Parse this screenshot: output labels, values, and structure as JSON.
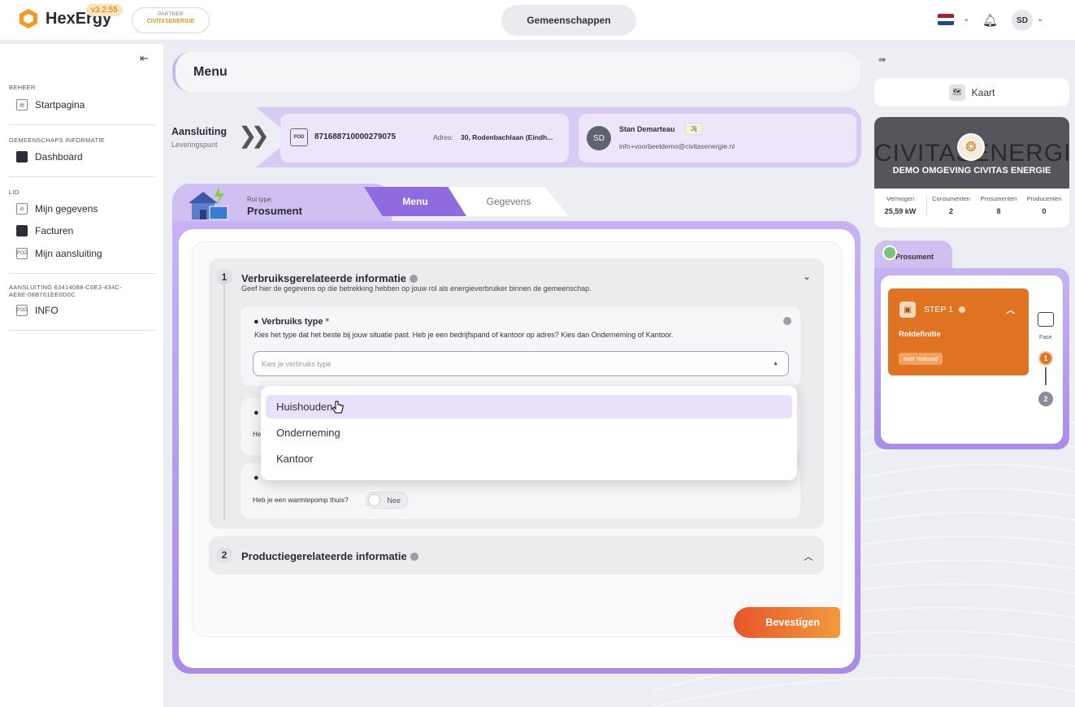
{
  "app": {
    "name": "HexErgy",
    "version": "v3.2.55",
    "partner_label": "PARTNER",
    "partner_name": "CIVITASENERGIE"
  },
  "header": {
    "center_button": "Gemeenschappen",
    "user_initials": "SD"
  },
  "sidebar": {
    "sections": [
      {
        "title": "BEHEER",
        "items": [
          {
            "label": "Startpagina"
          }
        ]
      },
      {
        "title": "GEMEENSCHAPS INFORMATIE",
        "items": [
          {
            "label": "Dashboard"
          }
        ]
      },
      {
        "title": "LID",
        "items": [
          {
            "label": "Mijn gegevens"
          },
          {
            "label": "Facturen"
          },
          {
            "label": "Mijn aansluiting"
          }
        ]
      },
      {
        "title": "AANSLUITING 63414088-C6E3-434C-AE8E-08B761EE0D0C",
        "items": [
          {
            "label": "INFO"
          }
        ]
      }
    ]
  },
  "page": {
    "title": "Menu"
  },
  "aansluiting": {
    "title": "Aansluiting",
    "subtitle": "Leveringspunt",
    "pod_icon": "POD",
    "ean": "871688710000279075",
    "address_label": "Adres:",
    "address": "30, Rodenbachlaan (Eindh...",
    "user_initials": "SD",
    "user_name": "Stan Demarteau",
    "user_tag": "Jij",
    "user_email": "info+voorbeeldemo@civitasenergie.nl"
  },
  "role": {
    "label": "Rol type:",
    "value": "Prosument"
  },
  "tabs": [
    {
      "label": "Menu",
      "active": true
    },
    {
      "label": "Gegevens",
      "active": false
    }
  ],
  "sections": [
    {
      "number": "1",
      "title": "Verbruiksgerelateerde informatie",
      "description": "Geef hier de gegevens op die betrekking hebben op jouw rol als energieverbruiker binnen de gemeenschap.",
      "fields": [
        {
          "label": "Verbruiks type",
          "required_mark": "*",
          "description": "Kies het type dat het beste bij jouw situatie past. Heb je een bedrijfspand of kantoor op adres? Kies dan Onderneming of Kantoor.",
          "placeholder": "Kies je verbruiks type",
          "options": [
            "Huishouden",
            "Onderneming",
            "Kantoor"
          ],
          "highlighted_option": "Huishouden"
        },
        {
          "hidden_text_prefix": "He"
        },
        {
          "question": "Heb je een warmtepomp thuis?",
          "toggle_value": "Nee"
        }
      ]
    },
    {
      "number": "2",
      "title": "Productiegerelateerde informatie"
    }
  ],
  "confirm_button": "Bevestigen",
  "right_panel": {
    "map_button": "Kaart",
    "community": {
      "banner_text": "CIVITASENERGIE",
      "banner_subtitle": "DEMO OMGEVING CIVITAS ENERGIE",
      "stats": [
        {
          "label": "Vermogen",
          "value": "25,59 kW"
        },
        {
          "label": "Consumenten",
          "value": "2"
        },
        {
          "label": "Prosumenten",
          "value": "8"
        },
        {
          "label": "Producenten",
          "value": "0"
        }
      ]
    },
    "role_tab": "Prosument",
    "step": {
      "label": "STEP 1",
      "title": "Roldefinitie",
      "status": "Niet Voltooid"
    },
    "phase": {
      "label": "Fase",
      "steps": [
        "1",
        "2"
      ]
    }
  },
  "colors": {
    "accent_purple": "#8e6ce0",
    "panel_purple": "#c7b3f1",
    "orange": "#e07321",
    "confirm_start": "#e8552a",
    "confirm_end": "#f29a3c"
  }
}
